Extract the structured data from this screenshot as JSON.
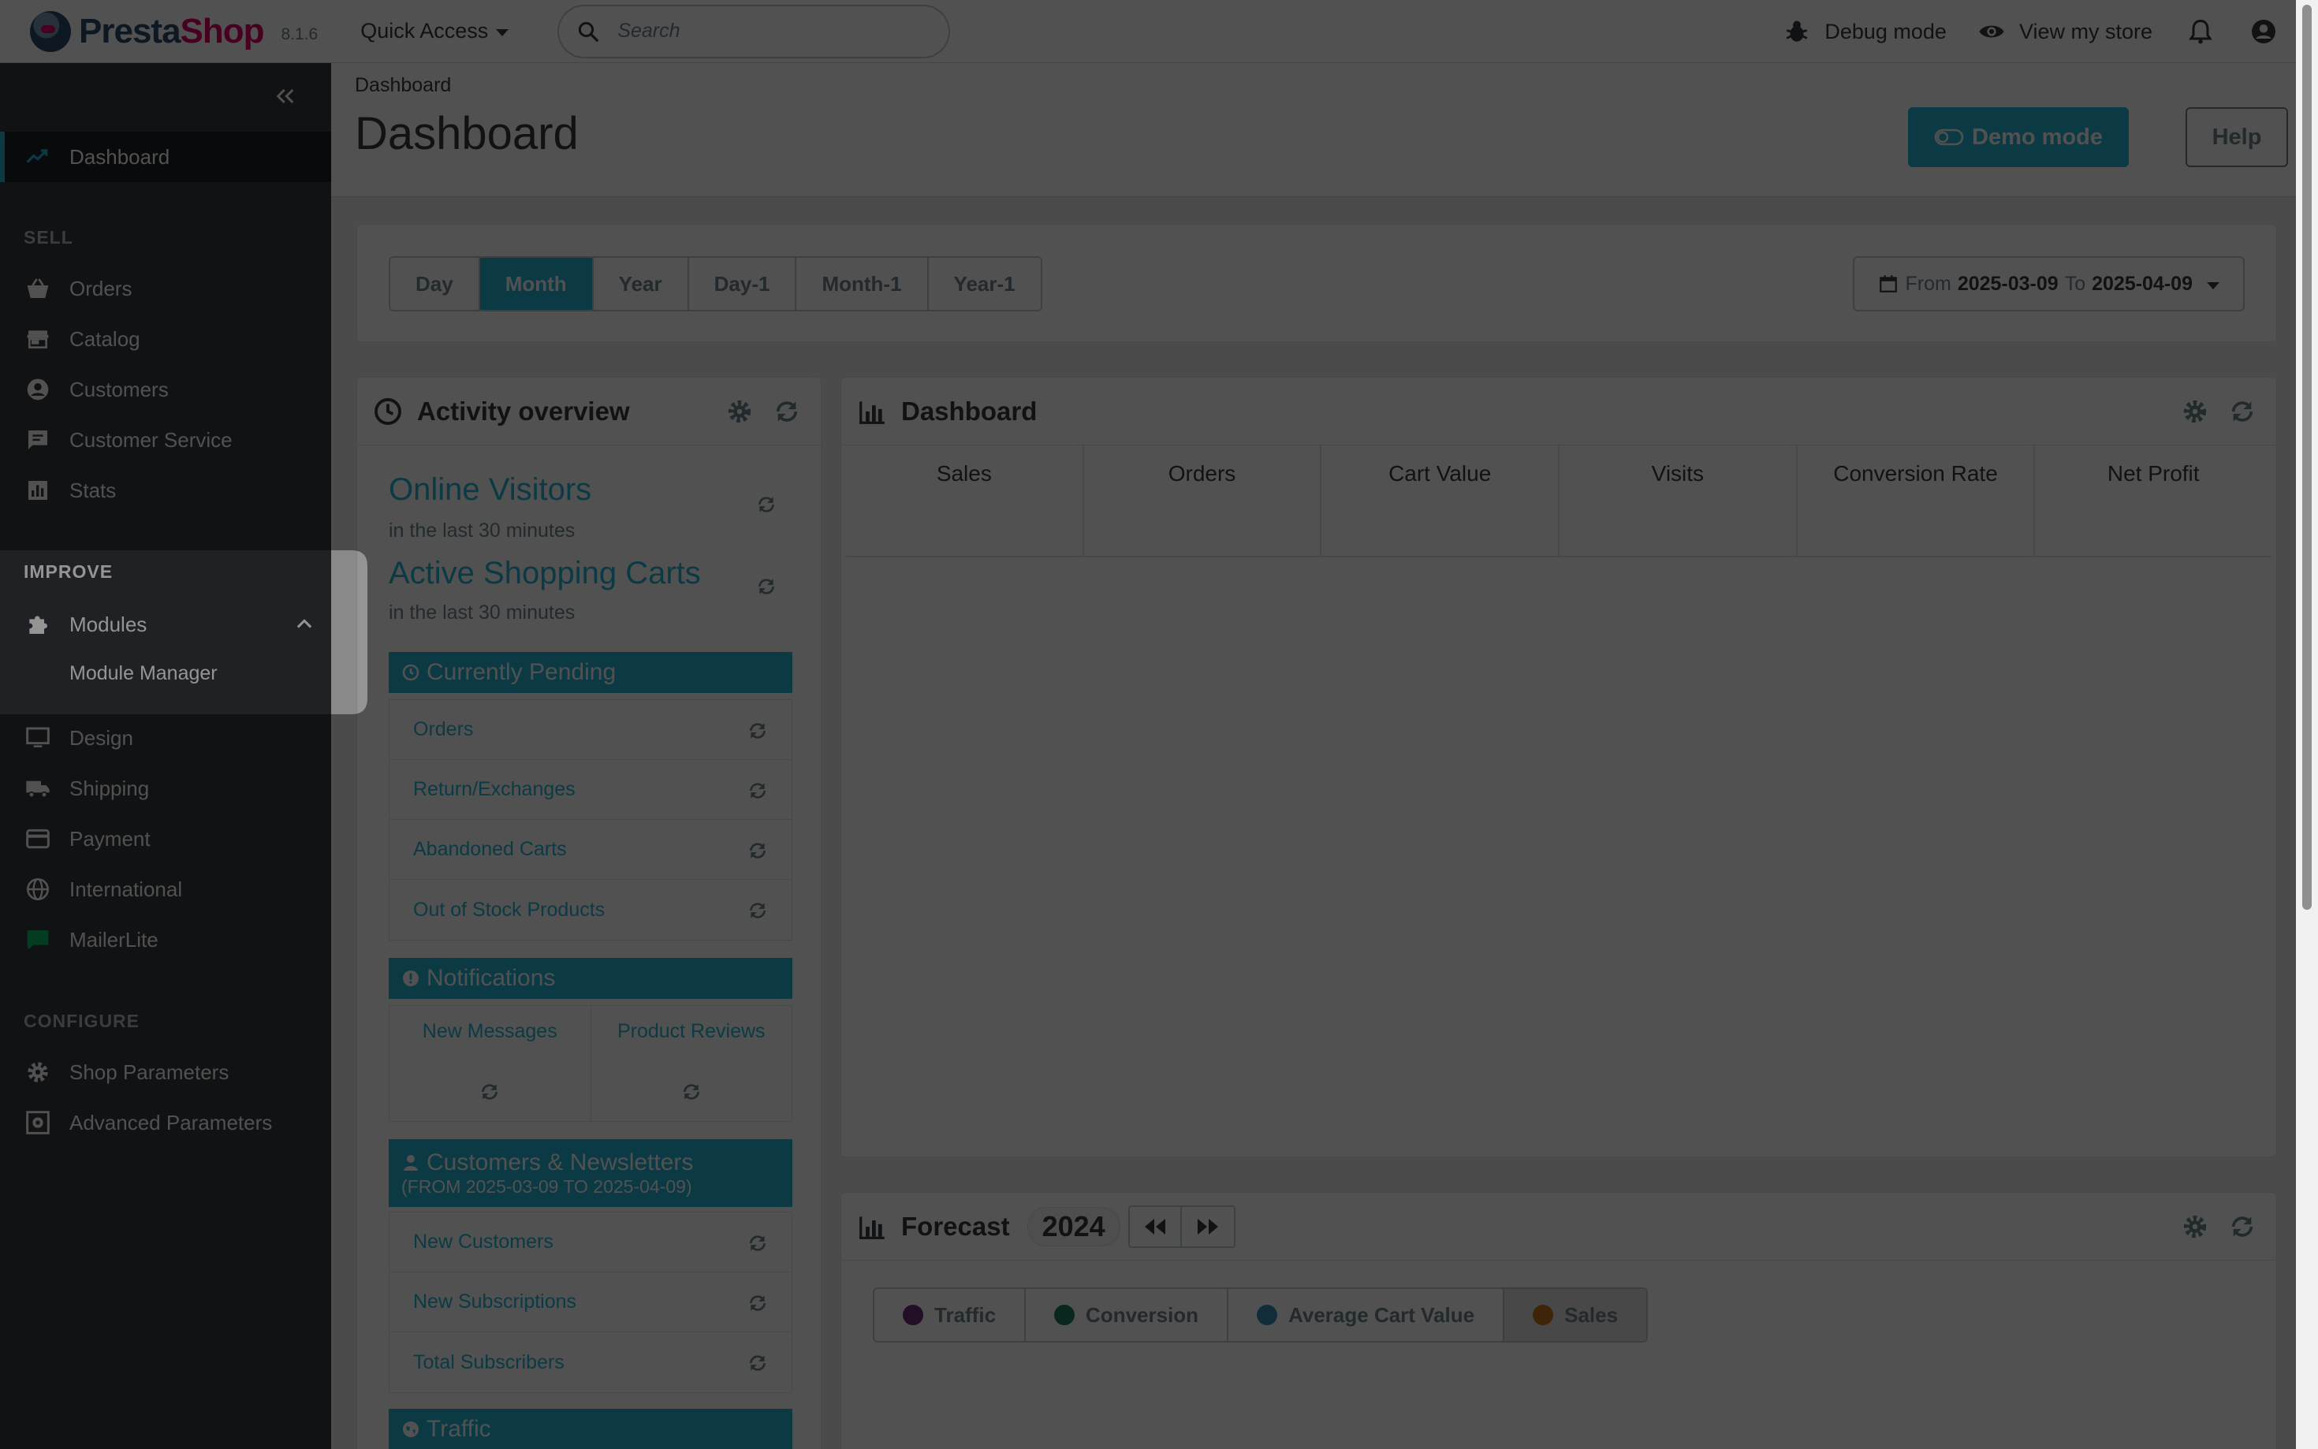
{
  "app": {
    "brand_part1": "Presta",
    "brand_part2": "Shop",
    "version": "8.1.6"
  },
  "header": {
    "quick_access": "Quick Access",
    "search_placeholder": "Search",
    "debug_mode": "Debug mode",
    "view_store": "View my store"
  },
  "sidebar": {
    "dashboard": "Dashboard",
    "sell_title": "SELL",
    "sell": [
      "Orders",
      "Catalog",
      "Customers",
      "Customer Service",
      "Stats"
    ],
    "improve_title": "IMPROVE",
    "modules": "Modules",
    "module_manager": "Module Manager",
    "improve": [
      "Design",
      "Shipping",
      "Payment",
      "International",
      "MailerLite"
    ],
    "configure_title": "CONFIGURE",
    "configure": [
      "Shop Parameters",
      "Advanced Parameters"
    ]
  },
  "page": {
    "breadcrumb": "Dashboard",
    "title": "Dashboard",
    "demo_mode": "Demo mode",
    "help": "Help"
  },
  "period": {
    "buttons": [
      "Day",
      "Month",
      "Year",
      "Day-1",
      "Month-1",
      "Year-1"
    ],
    "active": "Month",
    "from_label": "From",
    "from": "2025-03-09",
    "to_label": "To",
    "to": "2025-04-09"
  },
  "activity": {
    "title": "Activity overview",
    "online_visitors": "Online Visitors",
    "online_sub": "in the last 30 minutes",
    "active_carts": "Active Shopping Carts",
    "carts_sub": "in the last 30 minutes",
    "pending_title": "Currently Pending",
    "pending": [
      "Orders",
      "Return/Exchanges",
      "Abandoned Carts",
      "Out of Stock Products"
    ],
    "notifications_title": "Notifications",
    "notifications": [
      "New Messages",
      "Product Reviews"
    ],
    "customers_title": "Customers & Newsletters",
    "customers_range": "(FROM 2025-03-09 TO 2025-04-09)",
    "customers": [
      "New Customers",
      "New Subscriptions",
      "Total Subscribers"
    ],
    "traffic_title": "Traffic"
  },
  "dashboard_card": {
    "title": "Dashboard",
    "kpis": [
      "Sales",
      "Orders",
      "Cart Value",
      "Visits",
      "Conversion Rate",
      "Net Profit"
    ]
  },
  "forecast": {
    "title": "Forecast",
    "year": "2024",
    "metrics": [
      {
        "label": "Traffic",
        "color": "#6b2f7a"
      },
      {
        "label": "Conversion",
        "color": "#1f7a60"
      },
      {
        "label": "Average Cart Value",
        "color": "#3a8fb8"
      },
      {
        "label": "Sales",
        "color": "#c8741c"
      }
    ],
    "active_metric": "Sales"
  },
  "colors": {
    "primary": "#25b9d7",
    "sidebar": "#363a41",
    "text": "#363a41",
    "muted": "#6c868e"
  }
}
